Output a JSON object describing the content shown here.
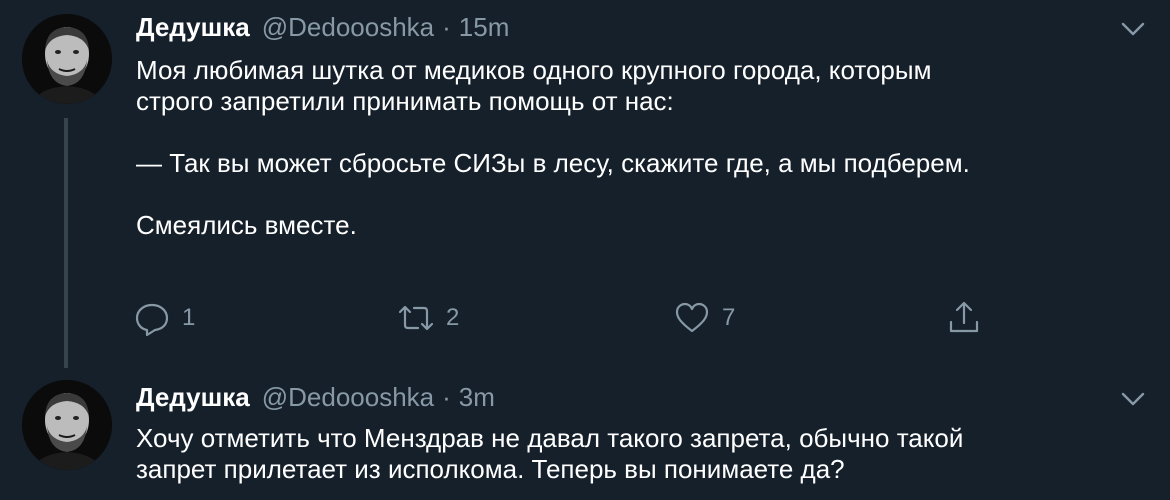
{
  "theme": {
    "background": "#15202b",
    "text_primary": "#ffffff",
    "text_secondary": "#8899a6",
    "thread_line": "#38444d"
  },
  "tweets": [
    {
      "display_name": "Дедушка",
      "handle": "@Dedoooshka",
      "separator": "·",
      "time": "15m",
      "menu_icon": "chevron-down-icon",
      "paragraphs": [
        "Моя любимая шутка от медиков одного крупного города, которым",
        "строго запретили принимать помощь от нас:",
        "",
        "— Так вы может сбросьте СИЗы в лесу, скажите где, а мы подберем.",
        "",
        "Смеялись вместе."
      ],
      "actions": {
        "reply": {
          "icon": "reply-icon",
          "count": "1"
        },
        "retweet": {
          "icon": "retweet-icon",
          "count": "2"
        },
        "like": {
          "icon": "heart-icon",
          "count": "7"
        },
        "share": {
          "icon": "share-icon"
        }
      }
    },
    {
      "display_name": "Дедушка",
      "handle": "@Dedoooshka",
      "separator": "·",
      "time": "3m",
      "menu_icon": "chevron-down-icon",
      "paragraphs": [
        "Хочу отметить что Менздрав не давал такого запрета, обычно такой",
        "запрет прилетает из исполкома. Теперь вы понимаете да?"
      ]
    }
  ]
}
